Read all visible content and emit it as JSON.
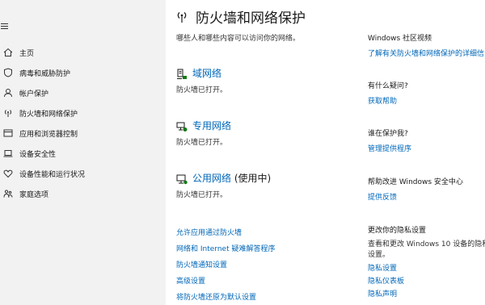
{
  "sidebar": {
    "items": [
      {
        "label": "主页",
        "icon": "home-icon"
      },
      {
        "label": "病毒和威胁防护",
        "icon": "shield-icon"
      },
      {
        "label": "帐户保护",
        "icon": "person-icon"
      },
      {
        "label": "防火墙和网络保护",
        "icon": "wifi-antenna-icon"
      },
      {
        "label": "应用和浏览器控制",
        "icon": "app-window-icon"
      },
      {
        "label": "设备安全性",
        "icon": "laptop-icon"
      },
      {
        "label": "设备性能和运行状况",
        "icon": "heart-icon"
      },
      {
        "label": "家庭选项",
        "icon": "family-icon"
      }
    ]
  },
  "main": {
    "title": "防火墙和网络保护",
    "subtitle": "哪些人和哪些内容可以访问你的网络。",
    "networks": [
      {
        "name": "域网络",
        "suffix": "",
        "status": "防火墙已打开。",
        "icon": "domain-network-icon"
      },
      {
        "name": "专用网络",
        "suffix": "",
        "status": "防火墙已打开。",
        "icon": "private-network-icon"
      },
      {
        "name": "公用网络",
        "suffix": " (使用中)",
        "status": "防火墙已打开。",
        "icon": "public-network-icon"
      }
    ],
    "links": [
      "允许应用通过防火墙",
      "网络和 Internet 疑难解答程序",
      "防火墙通知设置",
      "高级设置",
      "将防火墙还原为默认设置"
    ]
  },
  "right": {
    "community": {
      "heading": "Windows 社区视频",
      "link": "了解有关防火墙和网络保护的详细信"
    },
    "question": {
      "heading": "有什么疑问?",
      "link": "获取帮助"
    },
    "protector": {
      "heading": "谁在保护我?",
      "link": "管理提供程序"
    },
    "improve": {
      "heading": "帮助改进 Windows 安全中心",
      "link": "提供反馈"
    },
    "privacy": {
      "heading": "更改你的隐私设置",
      "text1": "查看和更改 Windows 10 设备的隐私",
      "text2": "设置。",
      "links": [
        "隐私设置",
        "隐私仪表板",
        "隐私声明"
      ]
    }
  },
  "colors": {
    "accent": "#0067b8",
    "sidebar_bg": "#f2f2f2"
  }
}
